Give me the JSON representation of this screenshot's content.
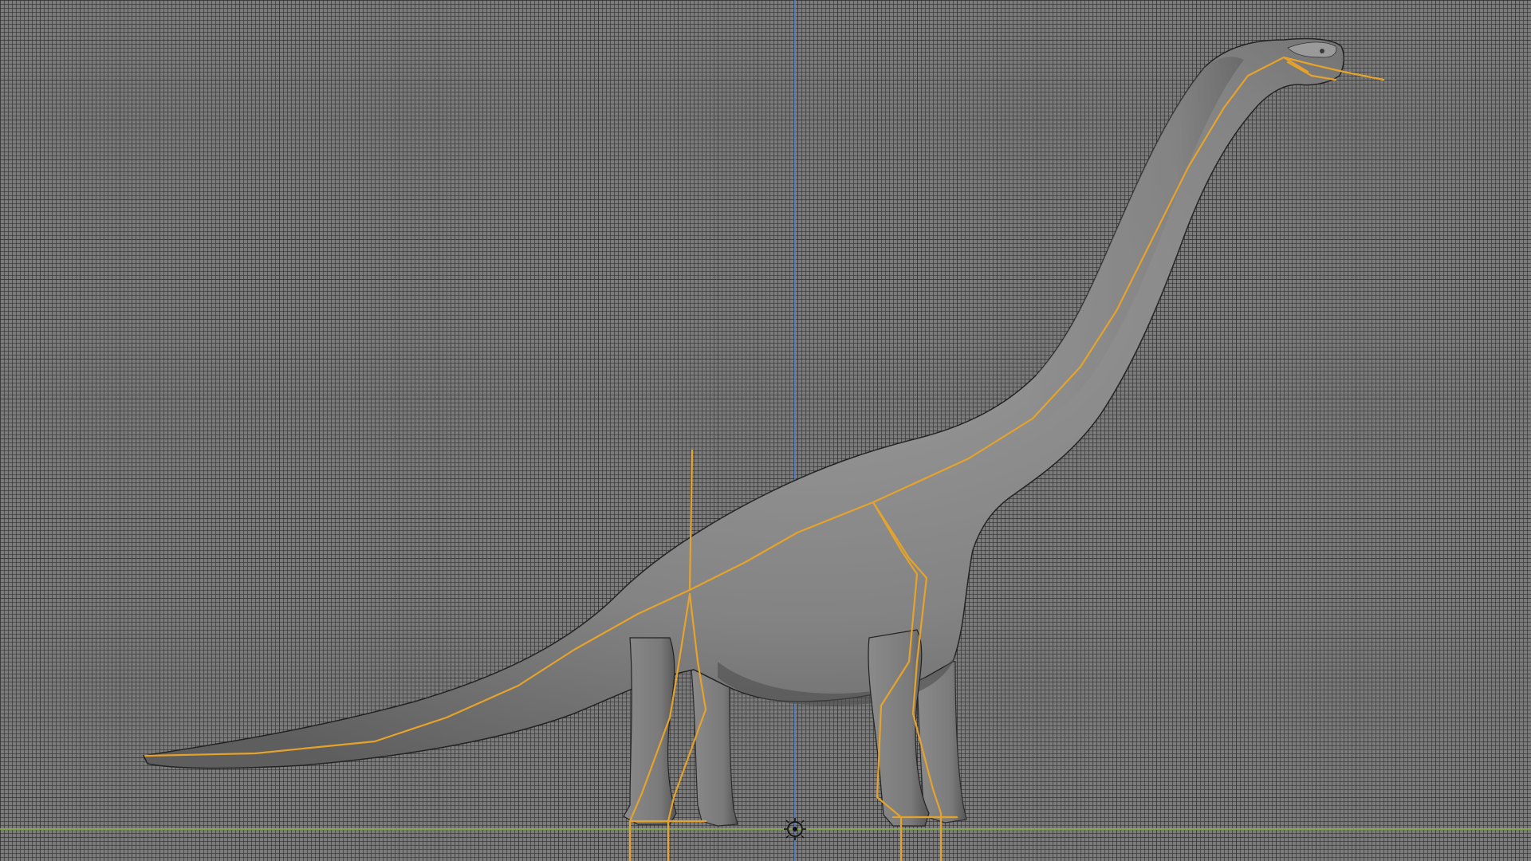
{
  "app": {
    "view": "3d-viewport",
    "shading": "solid",
    "mode": "object"
  },
  "viewport": {
    "grid": true,
    "background_color": "#7b7b7b",
    "grid_line_color": "#3c3c3c"
  },
  "axes": {
    "z_axis_color": "#4f7fd0",
    "y_axis_color": "#8fbf4a"
  },
  "object": {
    "mesh": "brachiosaurus-mesh",
    "armature": "brachiosaurus-armature",
    "mesh_color": "#808080",
    "armature_color": "#e6a32b",
    "origin_icon": "origin-icon"
  }
}
